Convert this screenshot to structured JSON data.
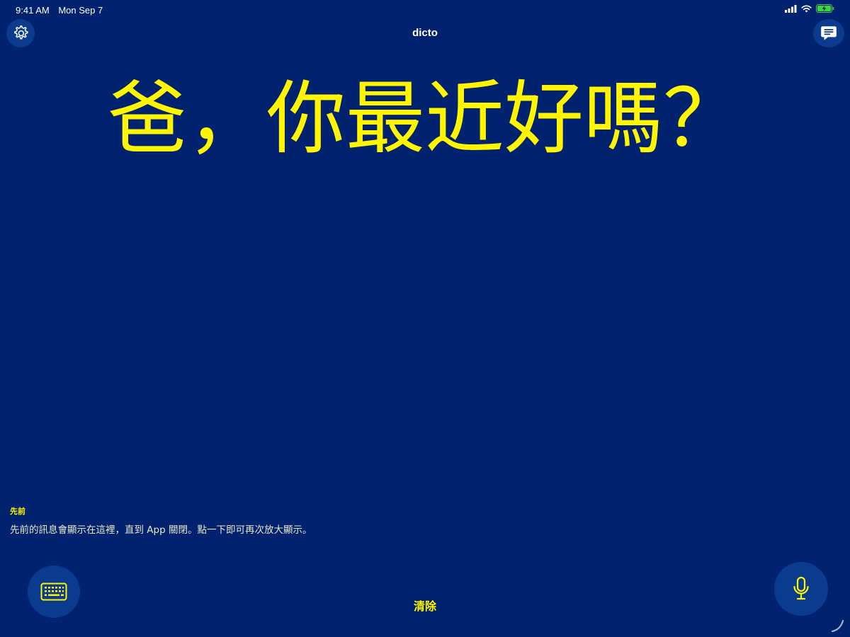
{
  "status_bar": {
    "time": "9:41 AM",
    "date": "Mon Sep 7",
    "signal_icon": "cellular-signal-icon",
    "wifi_icon": "wifi-icon",
    "battery_icon": "battery-charging-icon"
  },
  "nav": {
    "title": "dicto",
    "settings_icon": "gear-icon",
    "messages_icon": "message-bubble-icon"
  },
  "main": {
    "display_text": "爸，你最近好嗎？"
  },
  "previous": {
    "label": "先前",
    "description": "先前的訊息會顯示在這裡，直到 App 關閉。點一下即可再次放大顯示。"
  },
  "bottom": {
    "keyboard_icon": "keyboard-icon",
    "clear_label": "清除",
    "mic_icon": "microphone-icon"
  },
  "colors": {
    "background": "#00226f",
    "accent_yellow": "#fff500",
    "button_bg": "#0a3b8e"
  }
}
